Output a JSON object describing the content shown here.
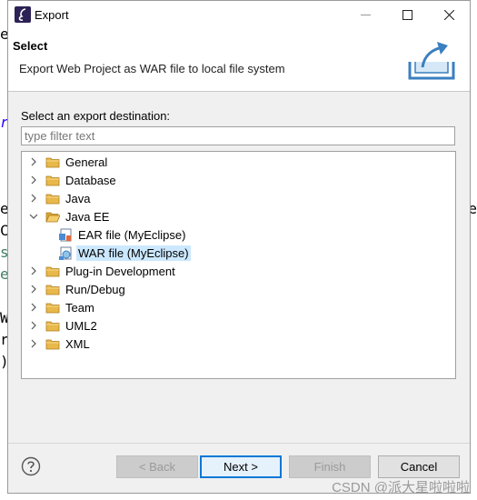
{
  "background": {
    "left_fragments": [
      {
        "text": "e",
        "color": "#000000"
      },
      {
        "text": "r",
        "color": "#2a00ff"
      },
      {
        "text": "e",
        "color": "#000000"
      },
      {
        "text": "C",
        "color": "#000000"
      },
      {
        "text": "s",
        "color": "#3f7f5f"
      },
      {
        "text": "e",
        "color": "#3f7f5f"
      },
      {
        "text": "W",
        "color": "#000000"
      },
      {
        "text": "r",
        "color": "#000000"
      },
      {
        "text": ")",
        "color": "#000000"
      }
    ],
    "right_fragments": [
      {
        "text": "e"
      }
    ]
  },
  "window": {
    "title": "Export",
    "controls": {
      "minimize": "—",
      "maximize": "☐",
      "close": "✕"
    }
  },
  "header": {
    "title": "Select",
    "description": "Export Web Project as WAR file to local file system"
  },
  "destination": {
    "label": "Select an export destination:",
    "filter_placeholder": "type filter text"
  },
  "tree": {
    "items": [
      {
        "label": "General",
        "expanded": false,
        "level": 0,
        "icon": "folder-icon"
      },
      {
        "label": "Database",
        "expanded": false,
        "level": 0,
        "icon": "folder-icon"
      },
      {
        "label": "Java",
        "expanded": false,
        "level": 0,
        "icon": "folder-icon"
      },
      {
        "label": "Java EE",
        "expanded": true,
        "level": 0,
        "icon": "folder-icon"
      },
      {
        "label": "EAR file (MyEclipse)",
        "level": 1,
        "icon": "ear-file-icon"
      },
      {
        "label": "WAR file (MyEclipse)",
        "level": 1,
        "icon": "war-file-icon",
        "selected": true
      },
      {
        "label": "Plug-in Development",
        "expanded": false,
        "level": 0,
        "icon": "folder-icon"
      },
      {
        "label": "Run/Debug",
        "expanded": false,
        "level": 0,
        "icon": "folder-icon"
      },
      {
        "label": "Team",
        "expanded": false,
        "level": 0,
        "icon": "folder-icon"
      },
      {
        "label": "UML2",
        "expanded": false,
        "level": 0,
        "icon": "folder-icon"
      },
      {
        "label": "XML",
        "expanded": false,
        "level": 0,
        "icon": "folder-icon"
      }
    ]
  },
  "buttons": {
    "back": "< Back",
    "next": "Next >",
    "finish": "Finish",
    "cancel": "Cancel"
  },
  "watermark": "CSDN @派大星啦啦啦",
  "colors": {
    "selection": "#cce8ff",
    "default_button_border": "#0078d7",
    "folder": "#e8b84a"
  }
}
